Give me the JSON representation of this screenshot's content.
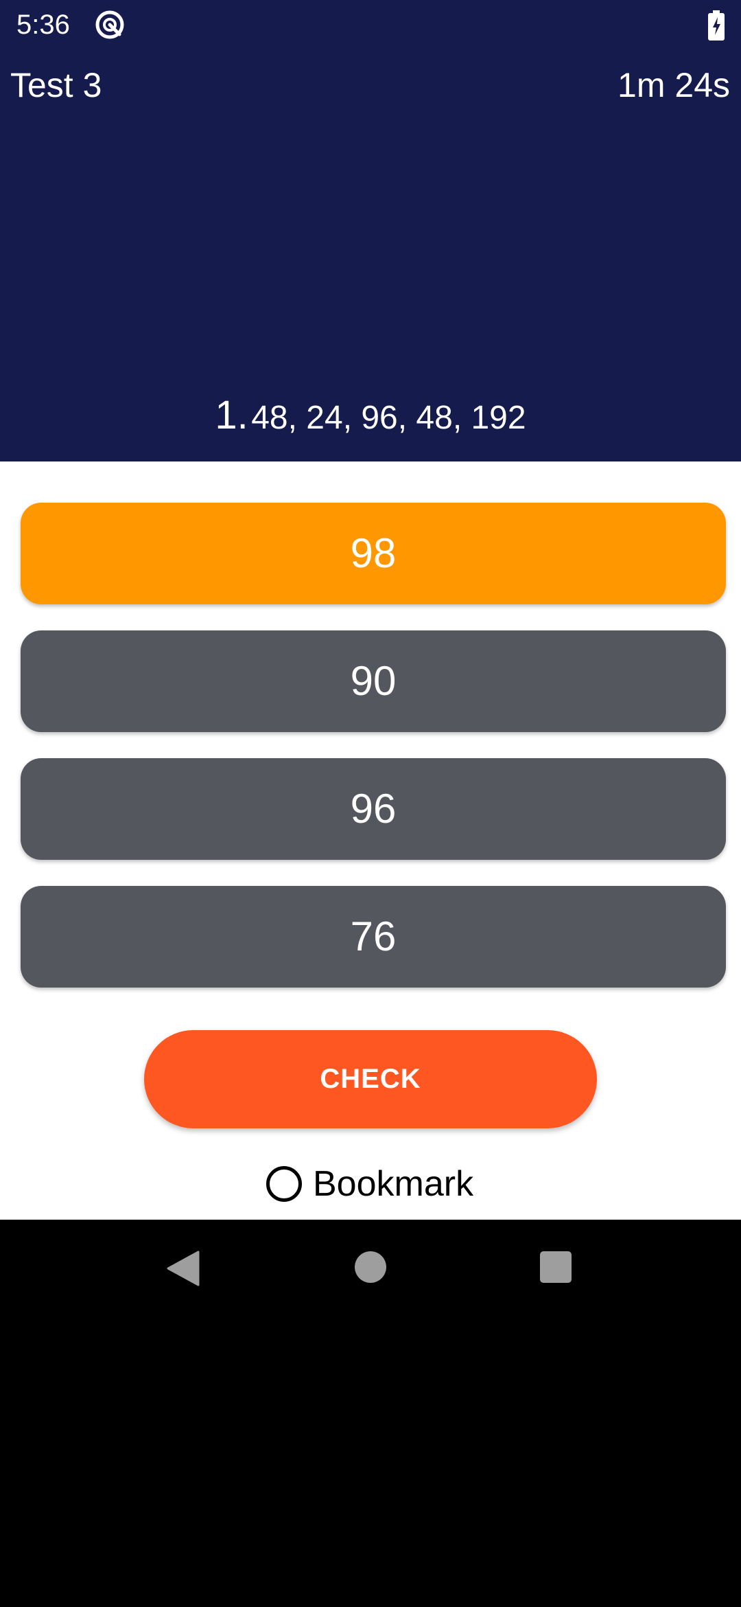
{
  "status_bar": {
    "time": "5:36",
    "app_icon": "circled-arrow-icon",
    "battery_icon": "battery-charging-icon"
  },
  "header": {
    "title": "Test 3",
    "timer": "1m 24s"
  },
  "question": {
    "number": "1.",
    "text": "48, 24, 96, 48, 192"
  },
  "options": [
    {
      "label": "98",
      "selected": true
    },
    {
      "label": "90",
      "selected": false
    },
    {
      "label": "96",
      "selected": false
    },
    {
      "label": "76",
      "selected": false
    }
  ],
  "actions": {
    "check_label": "CHECK",
    "bookmark_label": "Bookmark",
    "bookmark_checked": false
  },
  "nav_bar": {
    "back_icon": "back-triangle-icon",
    "home_icon": "home-circle-icon",
    "recents_icon": "recents-square-icon"
  },
  "colors": {
    "header_bg": "#161B4D",
    "option_selected": "#FF9800",
    "option_default": "#55575E",
    "check_button": "#FF5722",
    "nav_icon": "#9E9E9E"
  }
}
